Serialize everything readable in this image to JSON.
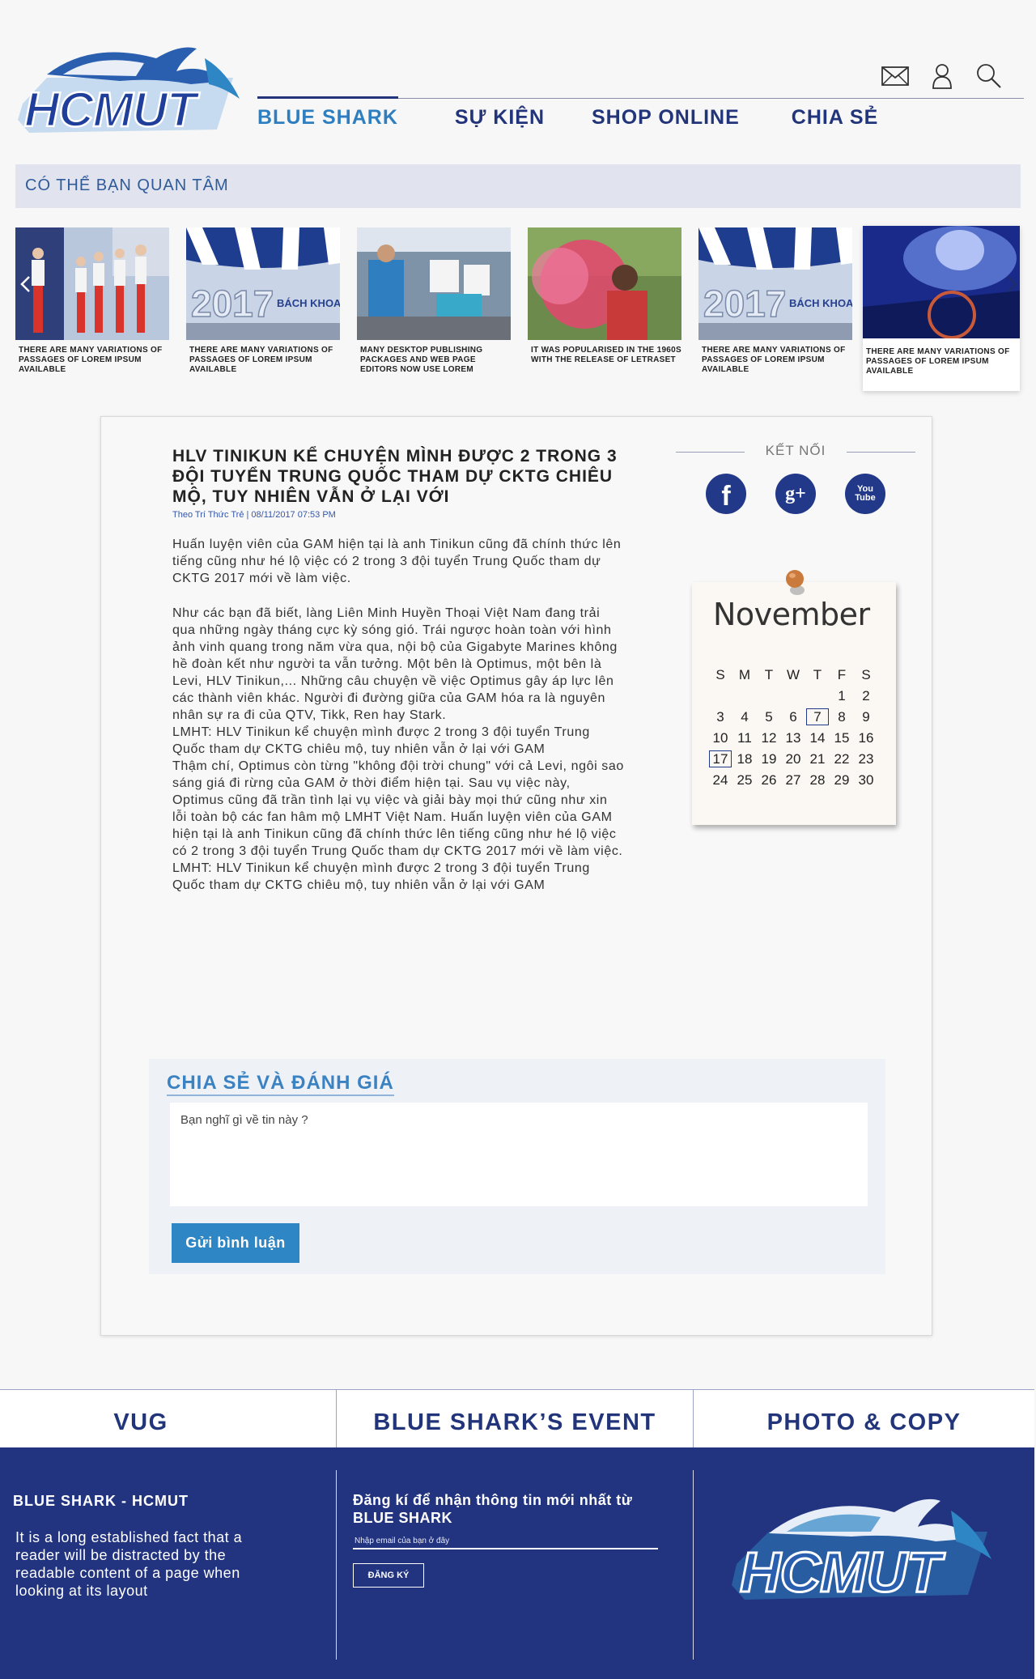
{
  "header": {
    "logo_text": "HCMUT",
    "nav": [
      {
        "label": "BLUE SHARK",
        "active": true
      },
      {
        "label": "SỰ KIỆN",
        "active": false
      },
      {
        "label": "SHOP ONLINE",
        "active": false
      },
      {
        "label": "CHIA SẺ",
        "active": false
      }
    ],
    "icons": [
      "mail-icon",
      "user-icon",
      "search-icon"
    ]
  },
  "interest": {
    "title": "CÓ THỂ BẠN QUAN TÂM",
    "cards": [
      {
        "caption": "THERE ARE MANY VARIATIONS OF PASSAGES OF LOREM IPSUM AVAILABLE"
      },
      {
        "caption": "THERE ARE MANY VARIATIONS OF PASSAGES OF LOREM IPSUM AVAILABLE"
      },
      {
        "caption": "MANY DESKTOP PUBLISHING PACKAGES AND WEB PAGE EDITORS NOW USE LOREM"
      },
      {
        "caption": " IT WAS POPULARISED IN THE 1960S WITH THE RELEASE OF LETRASET"
      },
      {
        "caption": "THERE ARE MANY VARIATIONS OF PASSAGES OF LOREM IPSUM AVAILABLE"
      },
      {
        "caption": "THERE ARE MANY VARIATIONS OF PASSAGES OF LOREM IPSUM AVAILABLE"
      }
    ],
    "thumb_year": "2017",
    "thumb_sign": "BÁCH KHOA"
  },
  "article": {
    "title": "HLV TINIKUN KỂ CHUYỆN MÌNH ĐƯỢC 2 TRONG 3 ĐỘI TUYỂN TRUNG QUỐC THAM DỰ CKTG CHIÊU MỘ, TUY NHIÊN VẪN Ở LẠI VỚI",
    "meta": "Theo Trí Thức Trẻ | 08/11/2017 07:53 PM",
    "p1": "Huấn luyện viên của GAM hiện tại là anh Tinikun cũng đã chính thức lên tiếng cũng như hé lộ việc có 2 trong 3 đội tuyển Trung Quốc tham dự CKTG 2017 mới về làm việc.",
    "p2": "Như các bạn đã biết, làng Liên Minh Huyền Thoại Việt Nam đang trải qua những ngày tháng cực kỳ sóng gió. Trái ngược hoàn toàn với hình ảnh vinh quang trong năm vừa qua, nội bộ của Gigabyte Marines không hề đoàn kết như người ta vẫn tưởng. Một bên là Optimus, một bên là Levi, HLV Tinikun,... Những câu chuyện về việc Optimus gây áp lực lên các thành viên khác. Người đi đường giữa của GAM hóa ra là nguyên nhân sự ra đi của QTV, Tikk, Ren hay Stark.",
    "p3": "LMHT: HLV Tinikun kể chuyện mình được 2 trong 3 đội tuyển Trung Quốc tham dự CKTG chiêu mộ, tuy nhiên vẫn ở lại với GAM",
    "p4": "Thậm chí, Optimus còn từng \"không đội trời chung\" với cả Levi, ngôi sao sáng giá đi rừng của GAM ở thời điểm hiện tại. Sau vụ việc này, Optimus cũng đã trần tình lại vụ việc và giải bày mọi thứ cũng như xin lỗi toàn bộ các fan hâm mộ LMHT Việt Nam. Huấn luyện viên của GAM hiện tại là anh Tinikun cũng đã chính thức lên tiếng cũng như hé lộ việc có 2 trong 3 đội tuyển Trung Quốc tham dự CKTG 2017 mới về làm việc.",
    "p5": "LMHT: HLV Tinikun kể chuyện mình được 2 trong 3 đội tuyển Trung Quốc tham dự CKTG chiêu mộ, tuy nhiên vẫn ở lại với GAM"
  },
  "sidebar": {
    "connect_label": "KẾT NỐI",
    "socials": [
      {
        "name": "facebook-icon",
        "glyph": "f"
      },
      {
        "name": "google-plus-icon",
        "glyph": "g+"
      },
      {
        "name": "youtube-icon",
        "glyph": "You\nTube"
      }
    ],
    "calendar": {
      "month": "November",
      "weekdays": [
        "S",
        "M",
        "T",
        "W",
        "T",
        "F",
        "S"
      ],
      "leading_blanks": 5,
      "days": 30,
      "boxed": [
        7,
        17
      ]
    }
  },
  "share": {
    "title": "CHIA SẺ VÀ ĐÁNH GIÁ",
    "placeholder": "Bạn nghĩ gì về tin này ?",
    "button": "Gửi bình luận"
  },
  "footer": {
    "tabs": [
      "VUG",
      "BLUE SHARK’S EVENT",
      "PHOTO & COPY"
    ],
    "brand": "BLUE SHARK - HCMUT",
    "description": "It is a long established fact that a reader will be distracted by the readable content of a page when looking at its layout",
    "subscribe_title": "Đăng kí để nhận thông tin mới nhất từ BLUE SHARK",
    "email_placeholder": "Nhập email của bạn ở đây",
    "subscribe_button": "ĐĂNG KÝ",
    "logo_text": "HCMUT"
  },
  "colors": {
    "navy": "#22347f",
    "accent_blue": "#2f86c5",
    "nav_active": "#2f7fc0",
    "light_panel": "#e1e4ee"
  }
}
